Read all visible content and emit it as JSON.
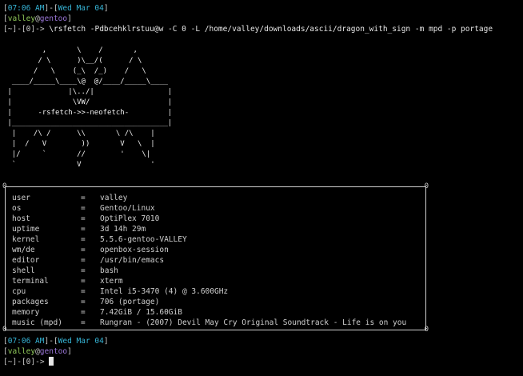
{
  "prompt1": {
    "time": "07:06 AM",
    "date": "Wed Mar 04",
    "user": "valley",
    "host": "gentoo",
    "path": "~",
    "exit": "0",
    "arrow": "->"
  },
  "command": "\\rsfetch -Pdbcehklrstuu@w -C 0 -L /home/valley/downloads/ascii/dragon_with_sign -m mpd -p portage",
  "ascii_art": "         ,       \\    /       ,\n        / \\      )\\__/(      / \\\n       /   \\    (_\\  /_)    /   \\\n  ____/_____\\____\\@  @/____/_____\\____\n |             |\\../|                 |\n |              \\VW/                  |\n |      -rsfetch->>-neofetch-         |\n |____________________________________|\n  |    /\\ /      \\\\       \\ /\\    |\n  |  /   V        ))       V   \\  |\n  |/     `       //        '    \\|\n  `              V                '",
  "info": [
    {
      "key": "user",
      "value": "valley"
    },
    {
      "key": "os",
      "value": "Gentoo/Linux"
    },
    {
      "key": "host",
      "value": "OptiPlex 7010"
    },
    {
      "key": "uptime",
      "value": "3d 14h 29m"
    },
    {
      "key": "kernel",
      "value": "5.5.6-gentoo-VALLEY"
    },
    {
      "key": "wm/de",
      "value": "openbox-session"
    },
    {
      "key": "editor",
      "value": "/usr/bin/emacs"
    },
    {
      "key": "shell",
      "value": "bash"
    },
    {
      "key": "terminal",
      "value": "xterm"
    },
    {
      "key": "cpu",
      "value": "Intel i5-3470 (4) @ 3.600GHz"
    },
    {
      "key": "packages",
      "value": "706 (portage)"
    },
    {
      "key": "memory",
      "value": "7.42GiB / 15.60GiB"
    },
    {
      "key": "music (mpd)",
      "value": "Rungran - (2007) Devil May Cry Original Soundtrack - Life is on you"
    }
  ],
  "info_separator": "=",
  "box_corner": "0",
  "prompt2": {
    "time": "07:06 AM",
    "date": "Wed Mar 04",
    "user": "valley",
    "host": "gentoo",
    "path": "~",
    "exit": "0",
    "arrow": "->"
  },
  "colors": {
    "background": "#000000",
    "time": "#36b4d6",
    "user": "#8fc85a",
    "host": "#9b77d9",
    "text": "#c8c8c8"
  }
}
